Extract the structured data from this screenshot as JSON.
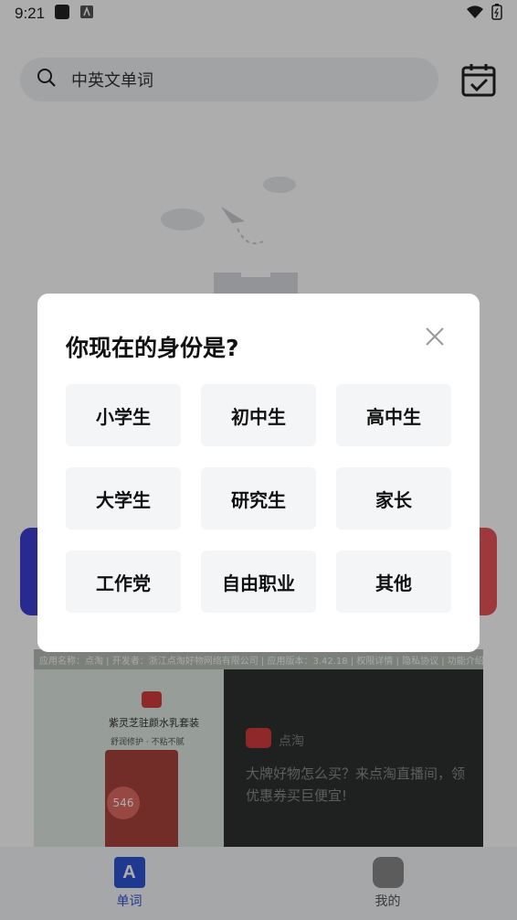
{
  "status_bar": {
    "time": "9:21"
  },
  "search": {
    "placeholder": "中英文单词"
  },
  "ad": {
    "meta_line": "应用名称：点淘 | 开发者：浙江点淘好物网络有限公司 | 应用版本：3.42.18 | 权限详情 | 隐私协议 | 功能介绍",
    "product_title": "紫灵芝驻颜水乳套装",
    "product_tags": "舒润修护 · 不粘不腻",
    "price": "546",
    "brand": "点淘",
    "description": "大牌好物怎么买？来点淘直播间，领优惠券买巨便宜!"
  },
  "tabs": [
    {
      "label": "单词",
      "icon_text": "A",
      "active": true
    },
    {
      "label": "我的",
      "active": false
    }
  ],
  "dialog": {
    "title": "你现在的身份是?",
    "options": [
      "小学生",
      "初中生",
      "高中生",
      "大学生",
      "研究生",
      "家长",
      "工作党",
      "自由职业",
      "其他"
    ]
  },
  "colors": {
    "accent_blue": "#2f55d4",
    "card_blue": "#3b3fd0",
    "card_red": "#e8555a"
  }
}
